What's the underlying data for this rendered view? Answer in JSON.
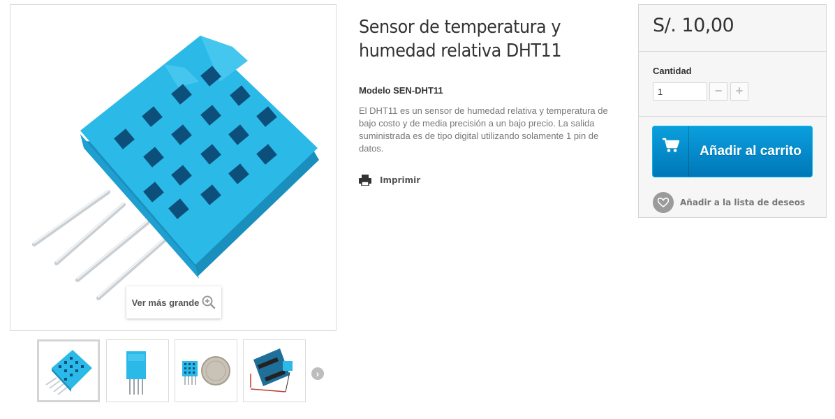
{
  "product": {
    "title": "Sensor de temperatura y humedad relativa DHT11",
    "model": "Modelo SEN-DHT11",
    "description": "El DHT11 es un sensor de humedad relativa y temperatura de bajo costo y de media precisión a un bajo precio. La salida suministrada es de tipo digital utilizando solamente 1 pin de datos.",
    "print_label": "Imprimir"
  },
  "gallery": {
    "zoom_label": "Ver más grande",
    "icons": [
      "zoom-in-icon",
      "chevron-right-icon"
    ],
    "thumbnails": [
      {
        "alt": "dht11-front",
        "active": true
      },
      {
        "alt": "dht11-back",
        "active": false
      },
      {
        "alt": "dht11-coin",
        "active": false
      },
      {
        "alt": "dht11-arduino",
        "active": false
      }
    ]
  },
  "buybox": {
    "price": "S/. 10,00",
    "quantity_label": "Cantidad",
    "quantity_value": "1",
    "minus": "−",
    "plus": "+",
    "add_to_cart": "Añadir al carrito",
    "wishlist": "Añadir a la lista de deseos"
  },
  "colors": {
    "cart_button": "#0b9fdd",
    "sensor_blue": "#29b6e5"
  }
}
